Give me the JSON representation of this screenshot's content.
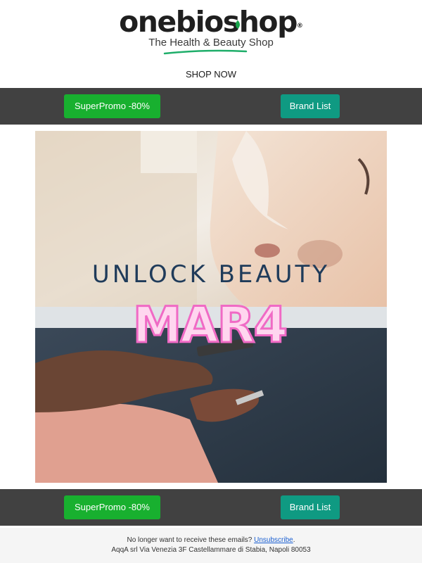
{
  "header": {
    "logo_text": "onebioshop",
    "logo_reg": "®",
    "tagline": "The Health & Beauty Shop",
    "shop_now": "SHOP NOW"
  },
  "nav_top": {
    "promo_label": "SuperPromo -80%",
    "brand_label": "Brand List"
  },
  "hero": {
    "headline": "UNLOCK BEAUTY",
    "code": "MAR4"
  },
  "nav_bottom": {
    "promo_label": "SuperPromo -80%",
    "brand_label": "Brand List"
  },
  "footer": {
    "prompt": "No longer want to receive these emails?",
    "unsubscribe": "Unsubscribe",
    "unsubscribe_suffix": ".",
    "address": "AqqA srl Via Venezia 3F Castellammare di Stabia, Napoli 80053"
  },
  "colors": {
    "bar_bg": "#414141",
    "promo_green": "#18b02f",
    "brand_teal": "#0f9a82",
    "link_blue": "#1a5fd1",
    "code_pink": "#f4a6d8",
    "headline_navy": "#1f3b5a"
  },
  "icons": {
    "logo_leaf": "leaf-icon"
  }
}
